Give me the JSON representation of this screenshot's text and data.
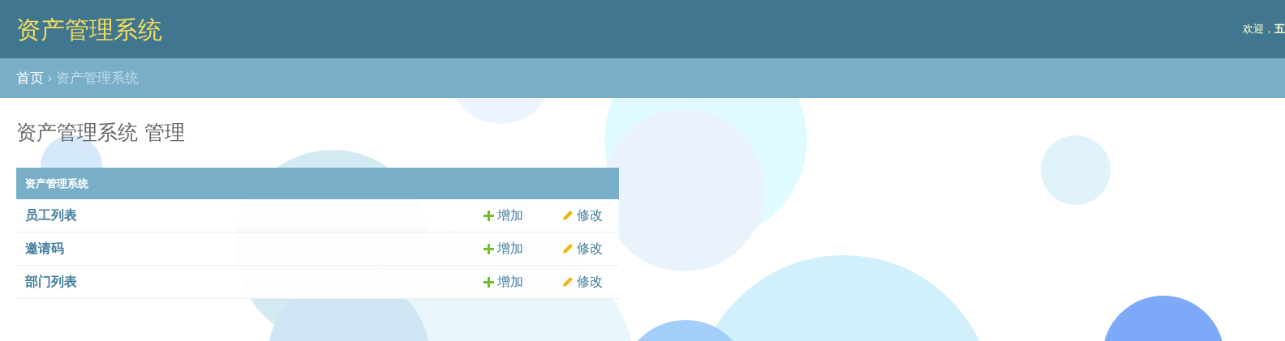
{
  "header": {
    "site_title": "资产管理系统",
    "welcome": "欢迎，",
    "user": "五"
  },
  "breadcrumbs": [
    {
      "label": "首页",
      "link": true
    },
    {
      "label": "资产管理系统",
      "link": false
    }
  ],
  "breadcrumb_separator": "›",
  "page_title": "资产管理系统 管理",
  "module": {
    "caption": "资产管理系统",
    "rows": [
      {
        "name": "员工列表",
        "add": "增加",
        "change": "修改"
      },
      {
        "name": "邀请码",
        "add": "增加",
        "change": "修改"
      },
      {
        "name": "部门列表",
        "add": "增加",
        "change": "修改"
      }
    ]
  }
}
